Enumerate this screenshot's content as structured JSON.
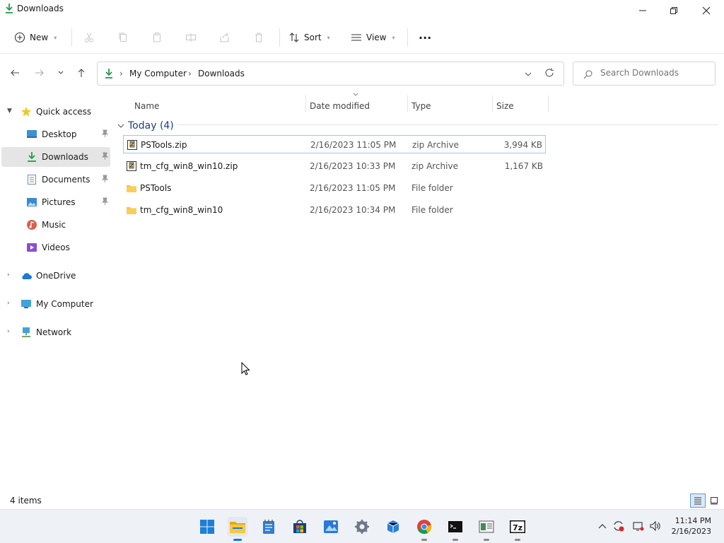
{
  "window": {
    "title": "Downloads"
  },
  "toolbar": {
    "new_label": "New",
    "sort_label": "Sort",
    "view_label": "View",
    "more_label": "..."
  },
  "address": {
    "crumbs": [
      "My Computer",
      "Downloads"
    ]
  },
  "search": {
    "placeholder": "Search Downloads"
  },
  "sidebar": {
    "quick_access": "Quick access",
    "items": [
      {
        "label": "Desktop",
        "pinned": true,
        "icon": "desktop-icon"
      },
      {
        "label": "Downloads",
        "pinned": true,
        "icon": "download-icon",
        "selected": true
      },
      {
        "label": "Documents",
        "pinned": true,
        "icon": "documents-icon"
      },
      {
        "label": "Pictures",
        "pinned": true,
        "icon": "pictures-icon"
      },
      {
        "label": "Music",
        "pinned": false,
        "icon": "music-icon"
      },
      {
        "label": "Videos",
        "pinned": false,
        "icon": "videos-icon"
      }
    ],
    "roots": [
      {
        "label": "OneDrive",
        "icon": "cloud-icon"
      },
      {
        "label": "My Computer",
        "icon": "computer-icon"
      },
      {
        "label": "Network",
        "icon": "network-icon"
      }
    ]
  },
  "table": {
    "columns": [
      "Name",
      "Date modified",
      "Type",
      "Size"
    ],
    "group_label": "Today (4)",
    "rows": [
      {
        "name": "PSTools.zip",
        "date": "2/16/2023 11:05 PM",
        "type": "zip Archive",
        "size": "3,994 KB",
        "kind": "zip"
      },
      {
        "name": "tm_cfg_win8_win10.zip",
        "date": "2/16/2023 10:33 PM",
        "type": "zip Archive",
        "size": "1,167 KB",
        "kind": "zip"
      },
      {
        "name": "PSTools",
        "date": "2/16/2023 11:05 PM",
        "type": "File folder",
        "size": "",
        "kind": "folder"
      },
      {
        "name": "tm_cfg_win8_win10",
        "date": "2/16/2023 10:34 PM",
        "type": "File folder",
        "size": "",
        "kind": "folder"
      }
    ]
  },
  "status": {
    "count": "4 items"
  },
  "taskbar": {
    "time": "11:14 PM",
    "date": "2/16/2023"
  },
  "colors": {
    "accent": "#1a73e8",
    "folder": "#f5c242",
    "download": "#1e9d4a",
    "selection": "#e5e5e5"
  }
}
